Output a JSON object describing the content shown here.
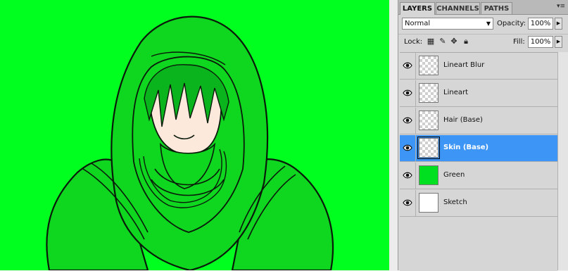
{
  "canvas": {
    "background_color": "#00ff1e",
    "description_icon": "hooded-figure-drawing"
  },
  "panel": {
    "tabs": [
      {
        "label": "LAYERS",
        "active": true
      },
      {
        "label": "CHANNELS",
        "active": false
      },
      {
        "label": "PATHS",
        "active": false
      }
    ],
    "menu_icon": "▾≡",
    "blend_mode": "Normal",
    "opacity_label": "Opacity:",
    "opacity_value": "100%",
    "lock_label": "Lock:",
    "fill_label": "Fill:",
    "fill_value": "100%",
    "layers": [
      {
        "name": "Lineart Blur",
        "visible": true,
        "thumb": "transparent",
        "selected": false
      },
      {
        "name": "Lineart",
        "visible": true,
        "thumb": "transparent",
        "selected": false
      },
      {
        "name": "Hair (Base)",
        "visible": true,
        "thumb": "transparent",
        "selected": false
      },
      {
        "name": "Skin (Base)",
        "visible": true,
        "thumb": "transparent",
        "selected": true
      },
      {
        "name": "Green",
        "visible": true,
        "thumb": "#00e020",
        "selected": false
      },
      {
        "name": "Sketch",
        "visible": true,
        "thumb": "#ffffff",
        "selected": false
      }
    ],
    "selection_color": "#3d95f5"
  }
}
